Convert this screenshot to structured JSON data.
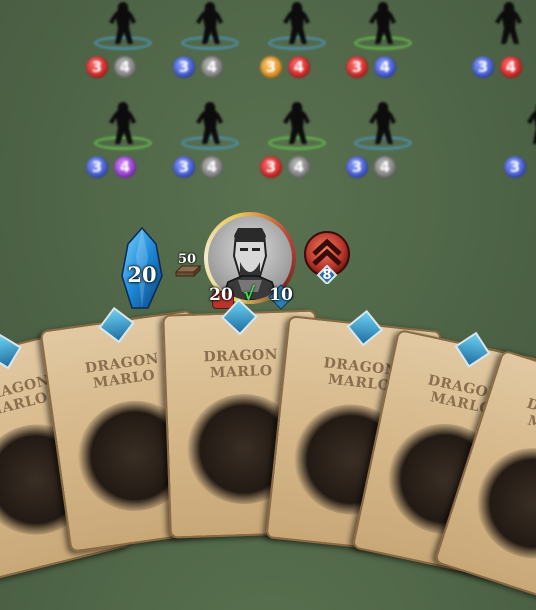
{
  "board": {
    "units": [
      {
        "atk": "3",
        "atk_color": "red",
        "hp": "4",
        "hp_color": "grey",
        "ring": "blue"
      },
      {
        "atk": "3",
        "atk_color": "blue",
        "hp": "4",
        "hp_color": "grey",
        "ring": "blue"
      },
      {
        "atk": "3",
        "atk_color": "orange",
        "hp": "4",
        "hp_color": "red",
        "ring": "blue"
      },
      {
        "atk": "3",
        "atk_color": "red",
        "hp": "4",
        "hp_color": "blue",
        "ring": "green"
      },
      {
        "atk": "3",
        "atk_color": "blue",
        "hp": "4",
        "hp_color": "red",
        "ring": "none"
      },
      {
        "atk": "3",
        "atk_color": "blue",
        "hp": "4",
        "hp_color": "purple",
        "ring": "green"
      },
      {
        "atk": "3",
        "atk_color": "blue",
        "hp": "4",
        "hp_color": "grey",
        "ring": "blue"
      },
      {
        "atk": "3",
        "atk_color": "red",
        "hp": "4",
        "hp_color": "grey",
        "ring": "green"
      },
      {
        "atk": "3",
        "atk_color": "blue",
        "hp": "4",
        "hp_color": "grey",
        "ring": "blue"
      },
      {
        "atk": "3",
        "atk_color": "blue",
        "hp": "",
        "hp_color": "grey",
        "ring": "none"
      }
    ]
  },
  "player": {
    "mana": "20",
    "deck_count": "50",
    "health": "20",
    "armor": "10",
    "ready_mark": "√",
    "rank_level": "8"
  },
  "hand": {
    "cards": [
      {
        "title": "DRAGON MARLO"
      },
      {
        "title": "DRAGON MARLO"
      },
      {
        "title": "DRAGON MARLO"
      },
      {
        "title": "DRAGON MARLO"
      },
      {
        "title": "DRAGON MARLO"
      },
      {
        "title": "DRAGON MARLO"
      }
    ]
  },
  "colors": {
    "background": "#4f6547",
    "crystal": "#1e8ad8",
    "card": "#d8bb8e"
  }
}
